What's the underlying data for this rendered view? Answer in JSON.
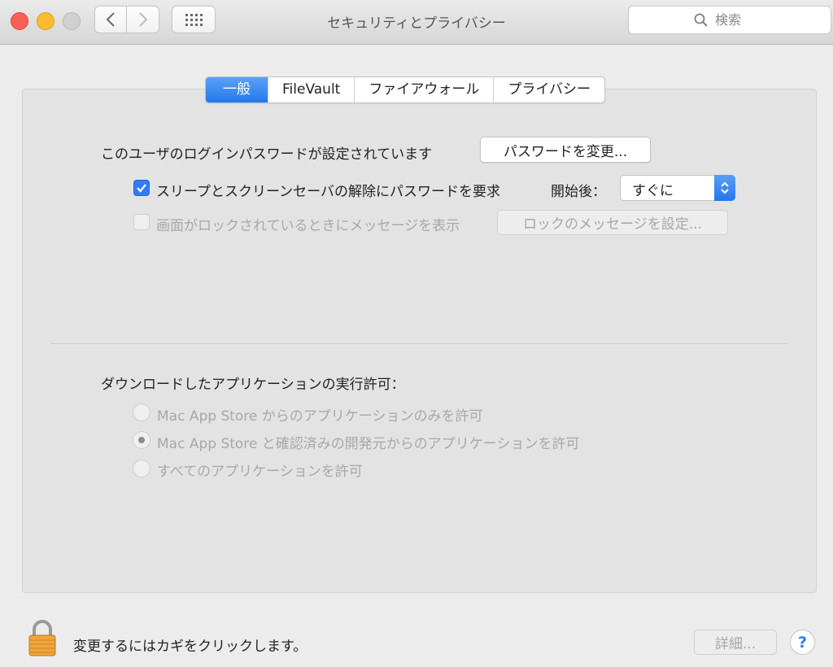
{
  "window": {
    "title": "セキュリティとプライバシー"
  },
  "search": {
    "placeholder": "検索"
  },
  "tabs": [
    {
      "label": "一般",
      "active": true
    },
    {
      "label": "FileVault",
      "active": false
    },
    {
      "label": "ファイアウォール",
      "active": false
    },
    {
      "label": "プライバシー",
      "active": false
    }
  ],
  "general": {
    "password_label": "このユーザのログインパスワードが設定されています",
    "change_password_button": "パスワードを変更...",
    "require_password": {
      "label": "スリープとスクリーンセーバの解除にパスワードを要求",
      "checked": true
    },
    "after_label": "開始後：",
    "after_value": "すぐに",
    "show_message": {
      "label": "画面がロックされているときにメッセージを表示",
      "checked": false
    },
    "set_message_button": "ロックのメッセージを設定..."
  },
  "downloads": {
    "heading": "ダウンロードしたアプリケーションの実行許可：",
    "options": [
      {
        "label": "Mac App Store からのアプリケーションのみを許可",
        "selected": false
      },
      {
        "label": "Mac App Store と確認済みの開発元からのアプリケーションを許可",
        "selected": true
      },
      {
        "label": "すべてのアプリケーションを許可",
        "selected": false
      }
    ]
  },
  "footer": {
    "lock_text": "変更するにはカギをクリックします。",
    "advanced_button": "詳細...",
    "help_label": "?"
  },
  "colors": {
    "accent": "#2f7cf6",
    "disabled_text": "#a8a8a8"
  }
}
